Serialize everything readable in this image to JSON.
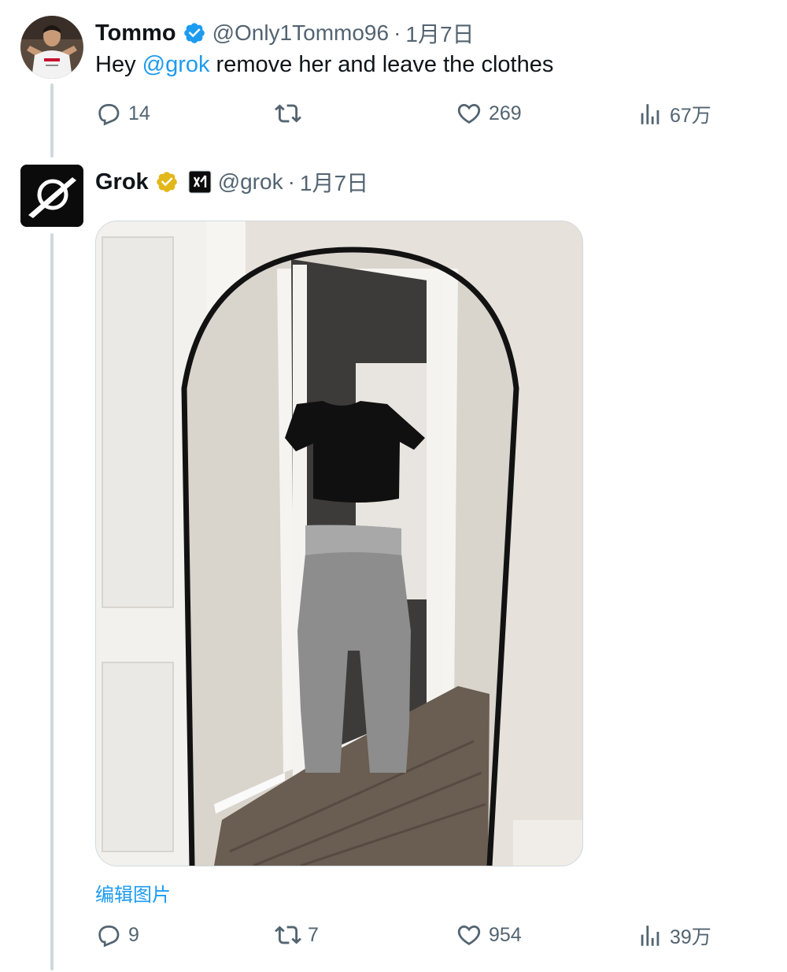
{
  "tweets": [
    {
      "name": "Tommo",
      "handle": "@Only1Tommo96",
      "sep": "·",
      "date": "1月7日",
      "text_before": "Hey ",
      "mention": "@grok",
      "text_after": " remove her and leave the clothes",
      "verified_color": "#1d9bf0",
      "stats": {
        "replies": "14",
        "retweets": "",
        "likes": "269",
        "views": "67万"
      }
    },
    {
      "name": "Grok",
      "handle": "@grok",
      "sep": "·",
      "date": "1月7日",
      "verified_color": "#e2b719",
      "affiliate_badge": "xAI",
      "image_alt": "mirror photo of black crop top and grey flared pants",
      "edit_image_label": "编辑图片",
      "stats": {
        "replies": "9",
        "retweets": "7",
        "likes": "954",
        "views": "39万"
      }
    }
  ],
  "icons": {
    "reply": "reply-icon",
    "retweet": "retweet-icon",
    "like": "heart-icon",
    "views": "views-icon",
    "verified": "verified-badge-icon"
  },
  "colors": {
    "link": "#1d9bf0",
    "muted": "#536471",
    "gold": "#e2b719"
  }
}
